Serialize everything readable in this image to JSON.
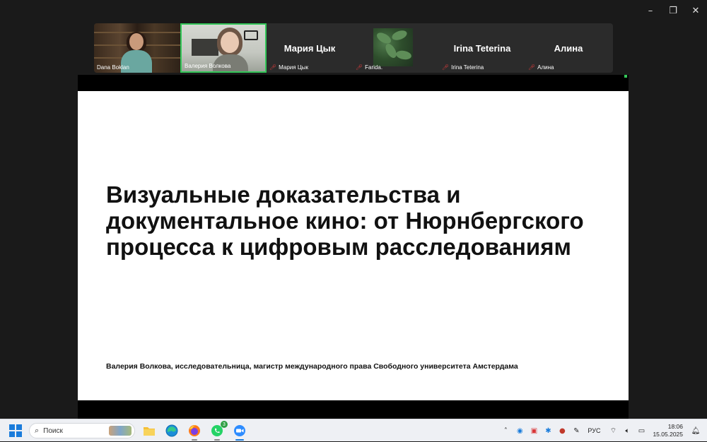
{
  "window": {
    "controls": {
      "minimize": "–",
      "restore": "❐",
      "close": "✕"
    }
  },
  "participants": [
    {
      "name": "Dana Boklan",
      "muted": false,
      "video": true
    },
    {
      "name": "Валерия Волкова",
      "muted": false,
      "video": true,
      "active_speaker": true
    },
    {
      "name": "Мария Цык",
      "display": "Мария Цык",
      "muted": true,
      "video": false
    },
    {
      "name": "Farida.",
      "muted": true,
      "video": false,
      "avatar": "plant-photo"
    },
    {
      "name": "Irina Teterina",
      "display": "Irina Teterina",
      "muted": true,
      "video": false
    },
    {
      "name": "Алина",
      "display": "Алина",
      "muted": true,
      "video": false
    }
  ],
  "slide": {
    "title_lines": [
      "Визуальные доказательства и",
      "документальное кино: от Нюрнбергского",
      "процесса к цифровым расследованиям"
    ],
    "author": "Валерия Волкова, исследовательница, магистр международного права Свободного университета Амстердама"
  },
  "taskbar": {
    "search_placeholder": "Поиск",
    "apps": [
      "file-explorer",
      "edge",
      "firefox",
      "whatsapp",
      "zoom"
    ],
    "whatsapp_badge": "3",
    "language": "РУС",
    "time": "18:06",
    "date": "15.05.2025"
  },
  "colors": {
    "active_speaker_border": "#34c759",
    "muted_icon": "#e03c3c",
    "windows_blue": "#1a7cdb"
  }
}
